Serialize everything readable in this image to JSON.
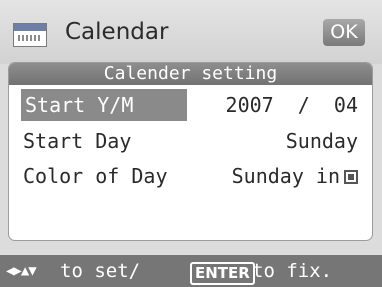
{
  "header": {
    "title": "Calendar",
    "ok_label": "OK",
    "icon": "calendar-icon"
  },
  "panel": {
    "title": "Calender setting",
    "rows": [
      {
        "label": "Start Y/M",
        "value": "2007  /  04",
        "selected": true
      },
      {
        "label": "Start Day",
        "value": "Sunday"
      },
      {
        "label": "Color of Day",
        "value": "Sunday in"
      }
    ]
  },
  "footer": {
    "arrows": "◀▶▲▼",
    "text1": "to set/",
    "enter_key": "ENTER",
    "text2": " to fix."
  },
  "colors": {
    "background": "#dcdcdc",
    "header_bar": "#7a7a7a",
    "selection": "#8a8a8a",
    "footer": "#767676"
  }
}
